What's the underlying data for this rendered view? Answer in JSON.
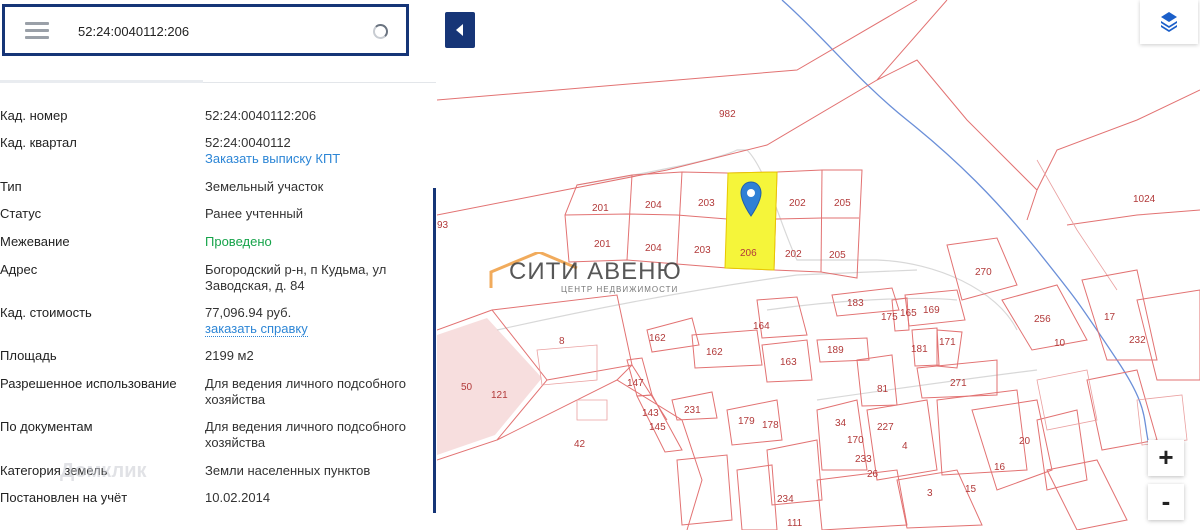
{
  "search": {
    "value": "52:24:0040112:206"
  },
  "details": [
    {
      "key": "Кад. номер",
      "value": "52:24:0040112:206"
    },
    {
      "key": "Кад. квартал",
      "value": "52:24:0040112",
      "link": "Заказать выписку КПТ"
    },
    {
      "key": "Тип",
      "value": "Земельный участок"
    },
    {
      "key": "Статус",
      "value": "Ранее учтенный"
    },
    {
      "key": "Межевание",
      "value": "Проведено"
    },
    {
      "key": "Адрес",
      "value": "Богородский р-н, п Кудьма, ул Заводская, д. 84"
    },
    {
      "key": "Кад. стоимость",
      "value": "77,096.94 руб.",
      "link": "заказать справку"
    },
    {
      "key": "Площадь",
      "value": "2199 м2"
    },
    {
      "key": "Разрешенное использование",
      "value": "Для ведения личного подсобного хозяйства"
    },
    {
      "key": "По документам",
      "value": "Для ведения личного подсобного хозяйства"
    },
    {
      "key": "Категория земель",
      "value": "Земли населенных пунктов"
    },
    {
      "key": "Постановлен на учёт",
      "value": "10.02.2014"
    }
  ],
  "map": {
    "zoom_in_label": "+",
    "zoom_out_label": "-",
    "watermark": {
      "title": "СИТИ АВЕНЮ",
      "subtitle": "ЦЕНТР НЕДВИЖИМОСТИ"
    },
    "watermark2": "Домклик",
    "highlight_color": "#f5f53a",
    "plot_labels": [
      "982",
      "1024",
      "201",
      "204",
      "203",
      "206",
      "202",
      "205",
      "201",
      "204",
      "203",
      "202",
      "205",
      "93",
      "270",
      "256",
      "17",
      "183",
      "175",
      "165",
      "169",
      "164",
      "162",
      "162",
      "163",
      "189",
      "181",
      "171",
      "10",
      "232",
      "8",
      "50",
      "121",
      "147",
      "143",
      "145",
      "231",
      "179",
      "178",
      "81",
      "271",
      "34",
      "227",
      "170",
      "233",
      "26",
      "4",
      "20",
      "16",
      "42",
      "234",
      "3",
      "15",
      "111"
    ]
  }
}
